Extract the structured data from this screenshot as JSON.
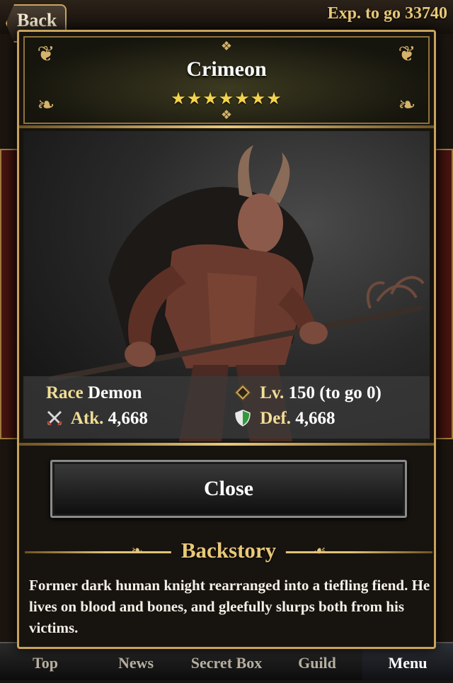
{
  "header": {
    "back_label": "Back",
    "exp_text": "Exp. to go 33740"
  },
  "card": {
    "name": "Crimeon",
    "stars": "★★★★★★★",
    "race_label": "Race",
    "race_value": "Demon",
    "level_label": "Lv.",
    "level_value": "150",
    "level_to_go": "(to go 0)",
    "atk_label": "Atk.",
    "atk_value": "4,668",
    "def_label": "Def.",
    "def_value": "4,668",
    "close_label": "Close",
    "backstory_title": "Backstory",
    "backstory_text": "Former dark human knight rearranged into a tiefling fiend. He lives on blood and bones, and gleefully slurps both from his victims."
  },
  "tabbar": {
    "tabs": [
      {
        "label": "Top"
      },
      {
        "label": "News"
      },
      {
        "label": "Secret Box"
      },
      {
        "label": "Guild"
      },
      {
        "label": "Menu"
      }
    ]
  },
  "icons": {
    "level": "diamond-icon",
    "attack": "crossed-swords-icon",
    "defense": "shield-icon"
  },
  "colors": {
    "gold": "#e9c978",
    "label_gold": "#f1dd95",
    "star": "#f2d34a"
  }
}
